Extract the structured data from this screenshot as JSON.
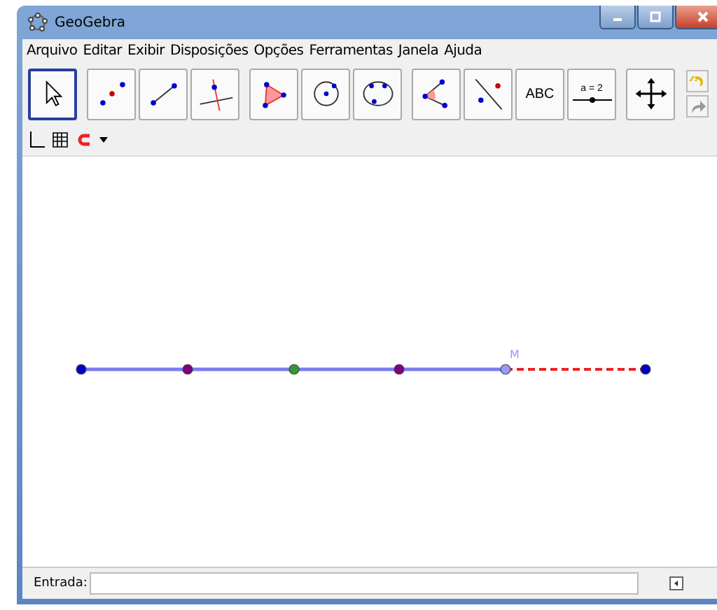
{
  "window": {
    "title": "GeoGebra"
  },
  "menu": [
    "Arquivo",
    "Editar",
    "Exibir",
    "Disposições",
    "Opções",
    "Ferramentas",
    "Janela",
    "Ajuda"
  ],
  "tools": [
    {
      "kind": "move",
      "selected": true
    },
    {
      "kind": "point",
      "selected": false
    },
    {
      "kind": "segment",
      "selected": false
    },
    {
      "kind": "perpendicular",
      "selected": false
    },
    {
      "kind": "polygon",
      "selected": false
    },
    {
      "kind": "circle",
      "selected": false
    },
    {
      "kind": "conic",
      "selected": false
    },
    {
      "kind": "angle",
      "selected": false
    },
    {
      "kind": "reflect",
      "selected": false
    },
    {
      "kind": "text",
      "selected": false,
      "label": "ABC"
    },
    {
      "kind": "slider",
      "selected": false,
      "label": "a = 2"
    },
    {
      "kind": "pan",
      "selected": false
    }
  ],
  "style_bar": [
    {
      "kind": "axes"
    },
    {
      "kind": "grid"
    },
    {
      "kind": "magnet"
    }
  ],
  "construction": {
    "point_label": "M",
    "points": [
      {
        "color": "#0000cc"
      },
      {
        "color": "#800080"
      },
      {
        "color": "#339933"
      },
      {
        "color": "#800080"
      },
      {
        "color": "#9999ff"
      },
      {
        "color": "#0000cc"
      }
    ]
  },
  "input_bar": {
    "label": "Entrada:"
  }
}
